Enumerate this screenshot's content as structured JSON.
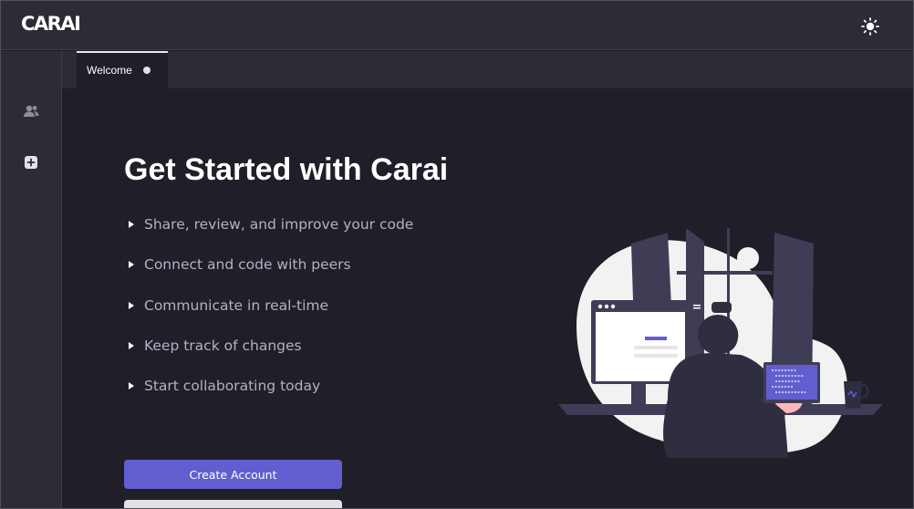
{
  "app": {
    "logo": "CARAI"
  },
  "header": {
    "theme_toggle_icon": "sun-icon"
  },
  "sidebar": {
    "items": [
      {
        "icon": "users-icon"
      },
      {
        "icon": "plus-square-icon"
      }
    ]
  },
  "tabs": [
    {
      "label": "Welcome",
      "active": true,
      "modified_indicator": "dot"
    }
  ],
  "welcome": {
    "title": "Get Started with Carai",
    "features": [
      "Share, review, and improve your code",
      "Connect and code with peers",
      "Communicate in real-time",
      "Keep track of changes",
      "Start collaborating today"
    ],
    "primary_button": "Create Account"
  },
  "colors": {
    "background": "#1f1e29",
    "chrome": "#2c2b36",
    "accent": "#625ecf",
    "text_muted": "#b4b2c2"
  }
}
